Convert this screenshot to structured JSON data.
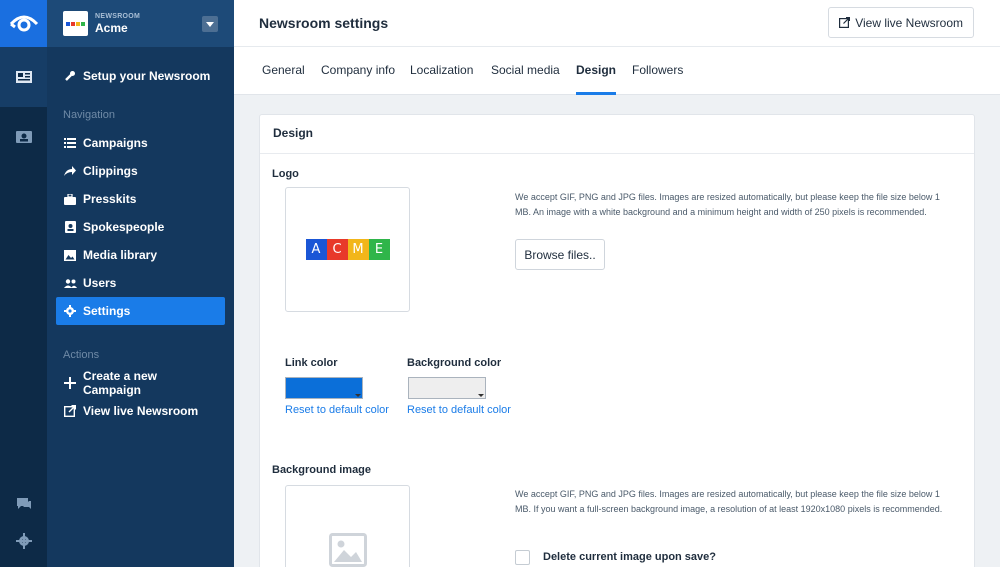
{
  "app": {
    "newsroom_label": "NEWSROOM",
    "newsroom_name": "Acme"
  },
  "sidebar": {
    "setup": "Setup your Newsroom",
    "nav_heading": "Navigation",
    "items": [
      {
        "label": "Campaigns",
        "icon": "list-icon"
      },
      {
        "label": "Clippings",
        "icon": "share-arrow-icon"
      },
      {
        "label": "Presskits",
        "icon": "briefcase-icon"
      },
      {
        "label": "Spokespeople",
        "icon": "person-card-icon"
      },
      {
        "label": "Media library",
        "icon": "image-icon"
      },
      {
        "label": "Users",
        "icon": "users-icon"
      },
      {
        "label": "Settings",
        "icon": "gear-icon",
        "active": true
      }
    ],
    "actions_heading": "Actions",
    "actions": [
      {
        "label": "Create a new Campaign",
        "icon": "plus-icon"
      },
      {
        "label": "View live Newsroom",
        "icon": "external-link-icon"
      }
    ]
  },
  "header": {
    "title": "Newsroom settings",
    "view_live": "View live Newsroom"
  },
  "tabs": [
    {
      "label": "General"
    },
    {
      "label": "Company info"
    },
    {
      "label": "Localization"
    },
    {
      "label": "Social media"
    },
    {
      "label": "Design",
      "active": true
    },
    {
      "label": "Followers"
    }
  ],
  "design": {
    "card_title": "Design",
    "logo_label": "Logo",
    "logo_letters": [
      "A",
      "C",
      "M",
      "E"
    ],
    "logo_colors": [
      "#1a56d6",
      "#e8392a",
      "#f2b61a",
      "#2fb54a"
    ],
    "logo_help": "We accept GIF, PNG and JPG files. Images are resized automatically, but please keep the file size below 1 MB. An image with a white background and a minimum height and width of 250 pixels is recommended.",
    "browse": "Browse files..",
    "link_color_label": "Link color",
    "link_color_value": "#0b6fd9",
    "bg_color_label": "Background color",
    "bg_color_value": "#eeeeee",
    "reset_link": "Reset to default color",
    "reset_bg": "Reset to default color",
    "bg_image_label": "Background image",
    "bg_help": "We accept GIF, PNG and JPG files. Images are resized automatically, but please keep the file size below 1 MB. If you want a full-screen background image, a resolution of at least 1920x1080 pixels is recommended.",
    "delete_label": "Delete current image upon save?"
  }
}
